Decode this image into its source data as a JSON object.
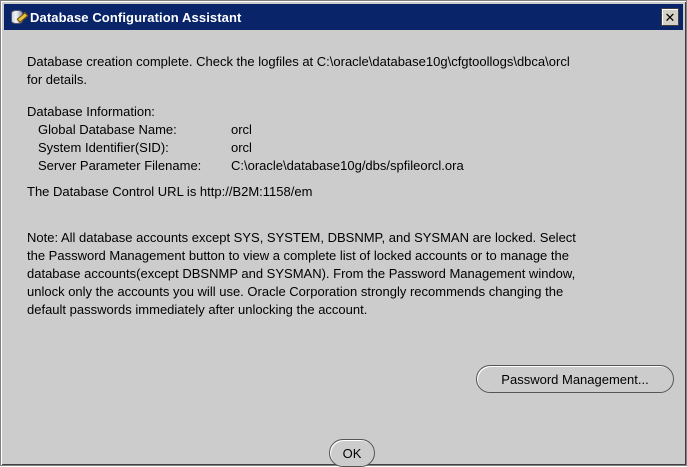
{
  "window": {
    "title": "Database Configuration Assistant",
    "close_glyph": "✕"
  },
  "message": {
    "line1": "Database creation complete. Check the logfiles at C:\\oracle\\database10g\\cfgtoollogs\\dbca\\orcl",
    "line2": "for details."
  },
  "info": {
    "heading": "Database Information:",
    "rows": [
      {
        "label": "Global Database Name:",
        "value": "orcl"
      },
      {
        "label": "System Identifier(SID):",
        "value": "orcl"
      },
      {
        "label": "Server Parameter Filename:",
        "value": "C:\\oracle\\database10g/dbs/spfileorcl.ora"
      }
    ]
  },
  "control_url": "The Database Control URL is http://B2M:1158/em",
  "note": {
    "lines": [
      "Note: All database accounts except SYS, SYSTEM, DBSNMP, and SYSMAN are locked. Select",
      "the Password Management button to view a complete list of locked accounts or to manage the",
      "database accounts(except DBSNMP and SYSMAN). From the Password Management window,",
      "unlock only the accounts you will use. Oracle Corporation strongly recommends changing the",
      "default passwords immediately after unlocking the account."
    ]
  },
  "buttons": {
    "password_management": "Password Management...",
    "ok": "OK"
  },
  "colors": {
    "titlebar": "#0a246a",
    "background": "#cccccc"
  }
}
